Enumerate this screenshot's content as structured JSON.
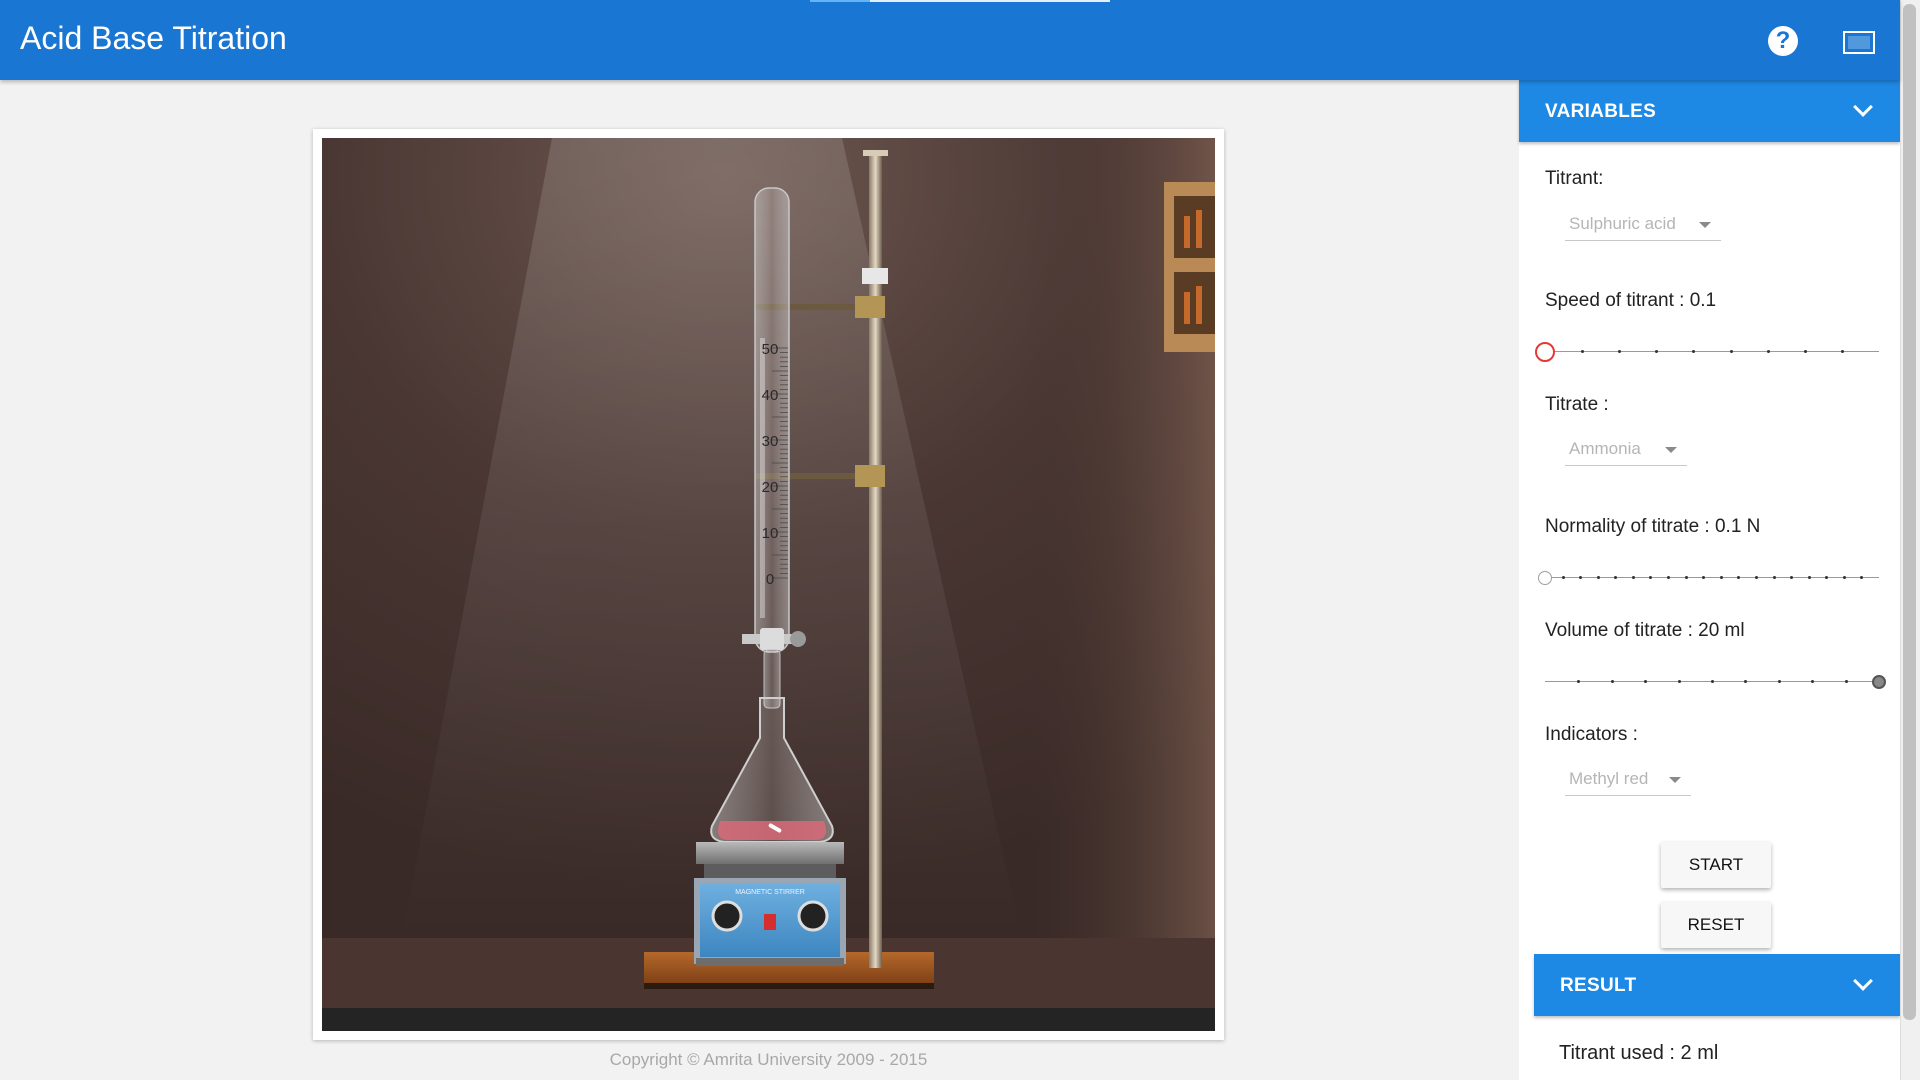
{
  "app": {
    "title": "Acid Base Titration"
  },
  "header": {
    "help_icon": "question-circle-icon",
    "help_glyph": "?",
    "fullscreen_icon": "fullscreen-icon"
  },
  "simulation": {
    "burette_scale": [
      "50",
      "40",
      "30",
      "20",
      "10",
      "0"
    ],
    "stirrer_label": "MAGNETIC STIRRER",
    "copyright": "Copyright © Amrita University 2009 - 2015"
  },
  "variables": {
    "header": "VARIABLES",
    "titrant_label": "Titrant:",
    "titrant_value": "Sulphuric acid",
    "speed_label": "Speed of titrant : 0.1",
    "speed_fraction": 0.0,
    "titrate_label": "Titrate :",
    "titrate_value": "Ammonia",
    "normality_label": "Normality of titrate : 0.1 N",
    "normality_fraction": 0.0,
    "volume_label": "Volume of titrate : 20 ml",
    "volume_fraction": 1.0,
    "indicators_label": "Indicators :",
    "indicators_value": "Methyl red",
    "start_label": "START",
    "reset_label": "RESET"
  },
  "result": {
    "header": "RESULT",
    "titrant_used": "Titrant used : 2 ml"
  },
  "colors": {
    "header_bg": "#1976d2",
    "panel_header_bg": "#1e88e5",
    "speed_thumb": "#e53935"
  }
}
